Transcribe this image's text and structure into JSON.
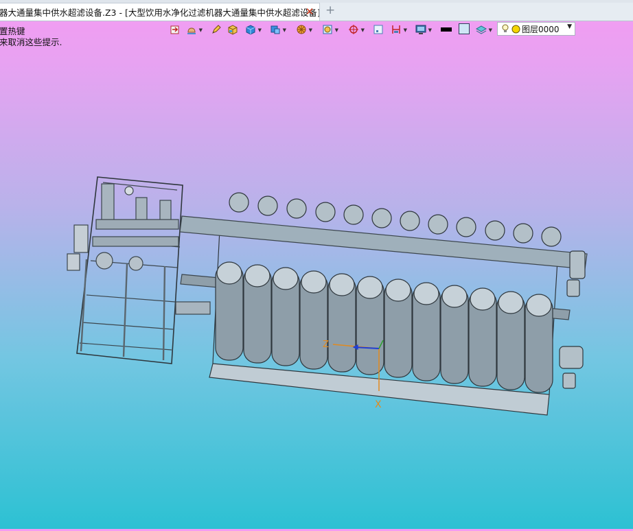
{
  "tabs": {
    "active_title": "器大通量集中供水超滤设备.Z3 - [大型饮用水净化过滤机器大通量集中供水超滤设备]",
    "close_icon": "close-icon",
    "new_tab_label": "+"
  },
  "hints": {
    "line1": "置热键",
    "line2": "来取消这些提示."
  },
  "toolbar": {
    "icons": [
      "import-icon",
      "hand-icon",
      "pencil-icon",
      "shaded-box-icon",
      "cube-icon",
      "shape-icon",
      "render-icon",
      "view-icon",
      "target-icon",
      "frame-icon",
      "clip-icon",
      "monitor-icon",
      "line-color-icon",
      "fill-color-icon",
      "layer-stack-icon"
    ]
  },
  "layer": {
    "name": "图层0000",
    "bulb_icon": "bulb-icon",
    "color_icon": "layer-color-icon"
  },
  "axes": {
    "x_label": "X",
    "z_label": "Z"
  },
  "colors": {
    "bg_top": "#f49bf2",
    "bg_bottom": "#2cc1d3",
    "model": "#94a4b0",
    "model_dark": "#3b454c",
    "close": "#d23a1d"
  }
}
